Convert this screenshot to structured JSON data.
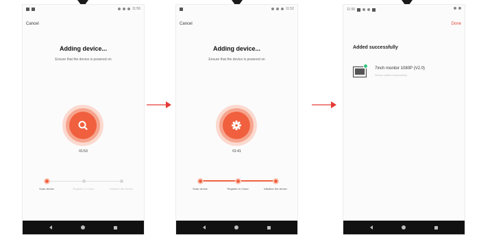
{
  "colors": {
    "accent": "#f0603f",
    "accent_light": "#fcc8b8",
    "badge": "#31c27c",
    "arrow": "#e53935"
  },
  "screens": [
    {
      "status_time": "11:56",
      "cancel": "Cancel",
      "title": "Adding device...",
      "subtitle": "Ensure that the device is powered on",
      "icon": "search-icon",
      "timer": "01:53",
      "steps": [
        {
          "label": "Scan device",
          "done": true
        },
        {
          "label": "Register to Cloud",
          "done": false
        },
        {
          "label": "Initialize the device",
          "done": false
        }
      ]
    },
    {
      "status_time": "11:52",
      "cancel": "Cancel",
      "title": "Adding device...",
      "subtitle": "Ensure that the device is powered on",
      "icon": "gear-icon",
      "timer": "01:41",
      "steps": [
        {
          "label": "Scan device",
          "done": true
        },
        {
          "label": "Register to Cloud",
          "done": true
        },
        {
          "label": "Initialize the device",
          "done": true
        }
      ]
    },
    {
      "status_time": "11:56",
      "done": "Done",
      "success": "Added successfully",
      "device_name": "7inch monitor 1080P (V2.0)",
      "device_sub": "Device added successfully"
    }
  ]
}
